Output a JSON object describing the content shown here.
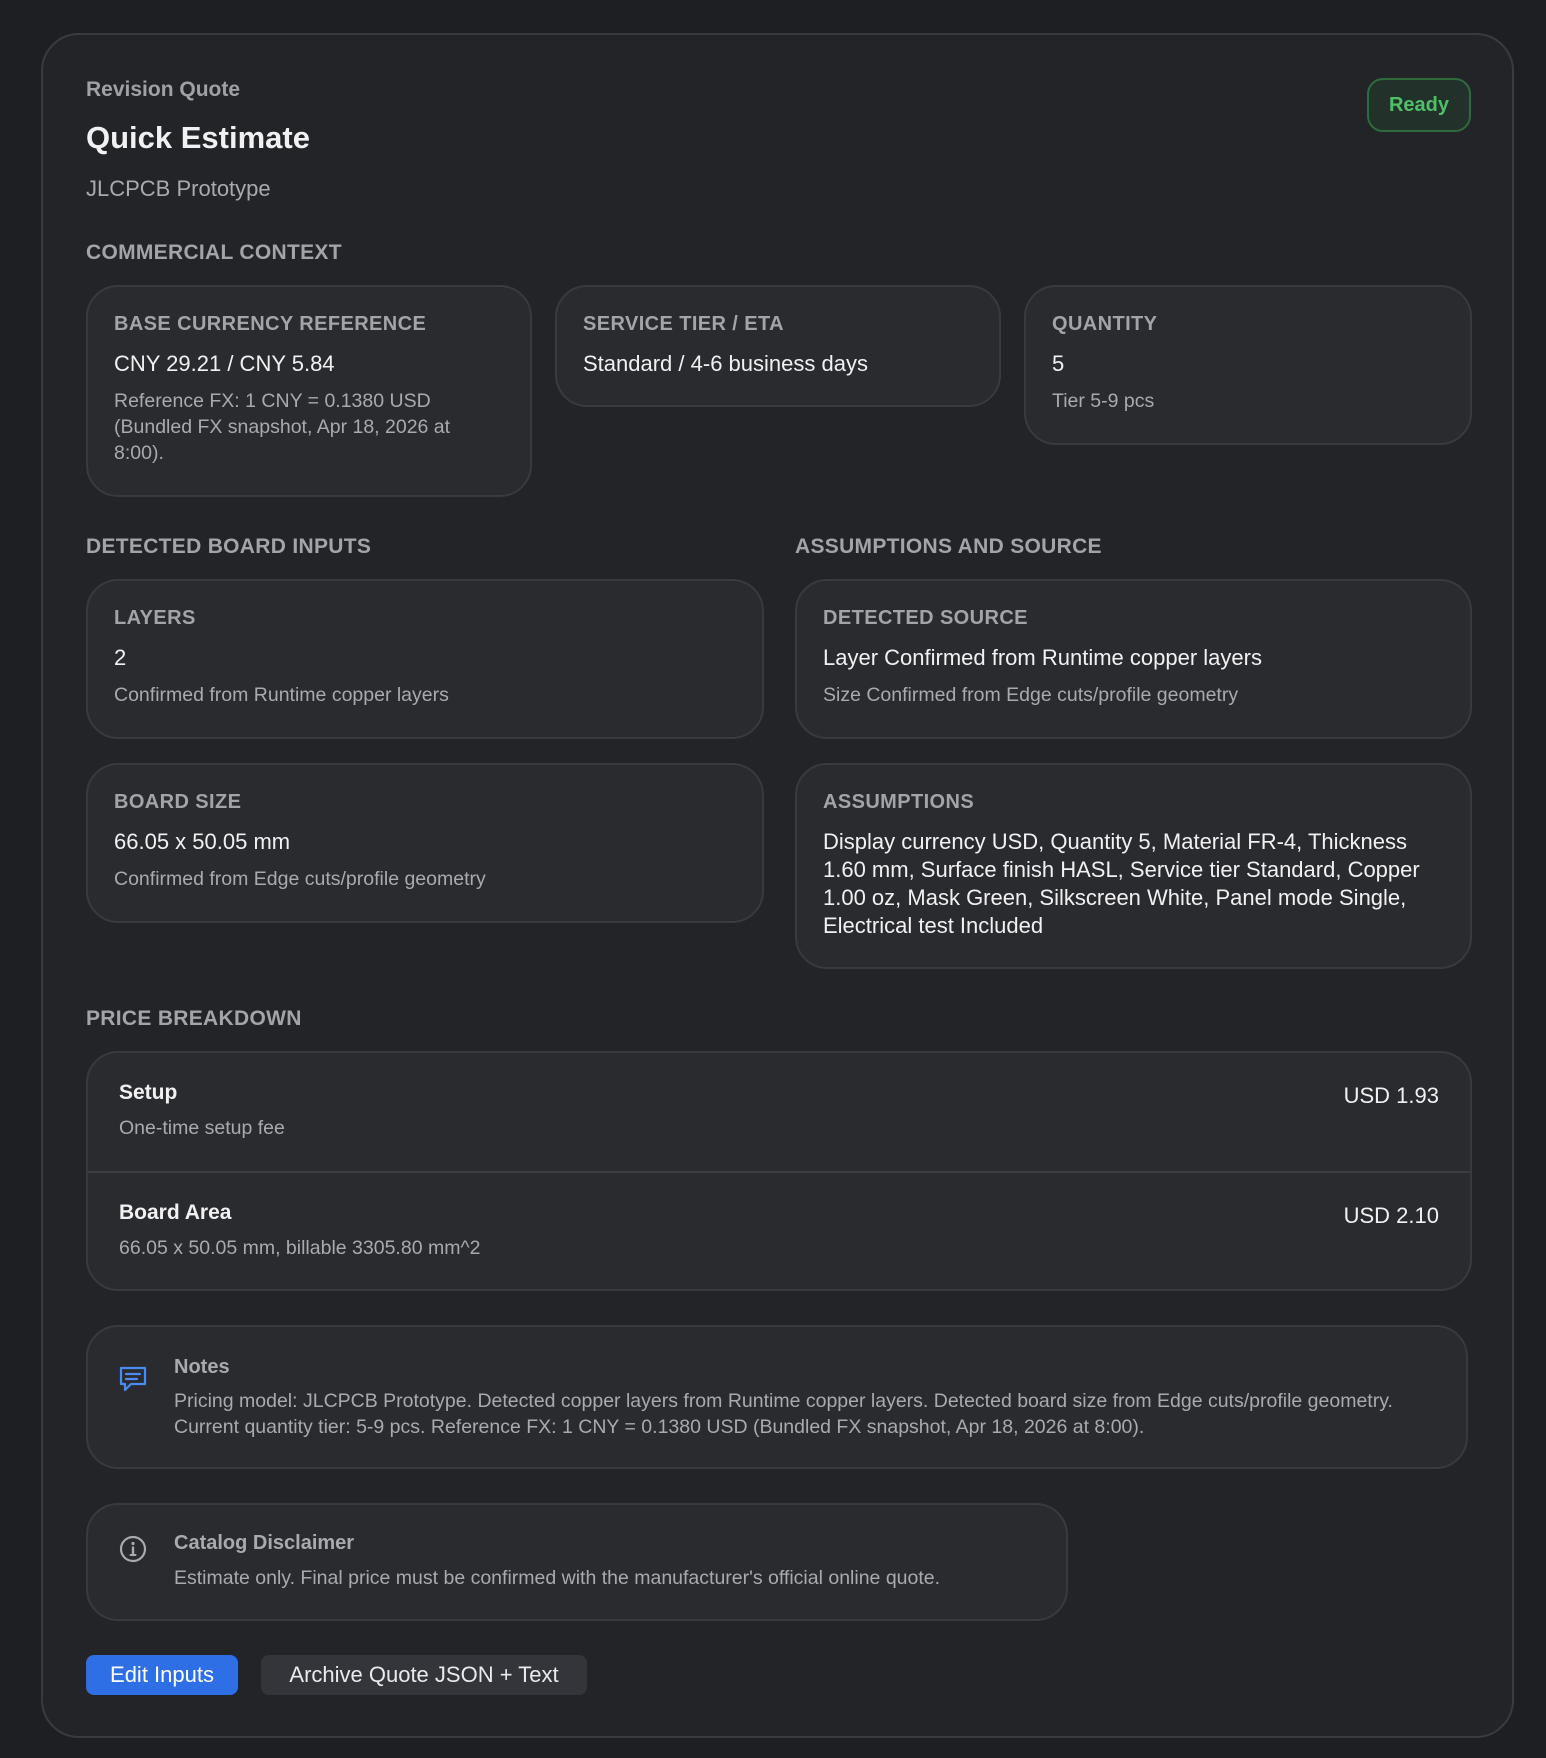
{
  "header": {
    "eyebrow": "Revision Quote",
    "title": "Quick Estimate",
    "subtitle": "JLCPCB Prototype",
    "status": "Ready"
  },
  "commercial": {
    "section_title": "COMMERCIAL CONTEXT",
    "base_currency": {
      "label": "BASE CURRENCY REFERENCE",
      "value": "CNY 29.21 / CNY 5.84",
      "sub": "Reference FX: 1 CNY = 0.1380 USD (Bundled FX snapshot, Apr 18, 2026 at 8:00)."
    },
    "service_tier": {
      "label": "SERVICE TIER / ETA",
      "value": "Standard / 4-6 business days"
    },
    "quantity": {
      "label": "QUANTITY",
      "value": "5",
      "sub": "Tier 5-9 pcs"
    }
  },
  "board_inputs": {
    "section_title": "DETECTED BOARD INPUTS",
    "layers": {
      "label": "LAYERS",
      "value": "2",
      "sub": "Confirmed from Runtime copper layers"
    },
    "board_size": {
      "label": "BOARD SIZE",
      "value": "66.05 x 50.05 mm",
      "sub": "Confirmed from Edge cuts/profile geometry"
    }
  },
  "assumptions_source": {
    "section_title": "ASSUMPTIONS AND SOURCE",
    "detected_source": {
      "label": "DETECTED SOURCE",
      "value": "Layer Confirmed from Runtime copper layers",
      "sub": "Size Confirmed from Edge cuts/profile geometry"
    },
    "assumptions": {
      "label": "ASSUMPTIONS",
      "value": "Display currency USD, Quantity 5, Material FR-4, Thickness 1.60 mm, Surface finish HASL, Service tier Standard, Copper 1.00 oz, Mask Green, Silkscreen White, Panel mode Single, Electrical test Included"
    }
  },
  "price_breakdown": {
    "section_title": "PRICE BREAKDOWN",
    "rows": [
      {
        "name": "Setup",
        "desc": "One-time setup fee",
        "amount": "USD 1.93"
      },
      {
        "name": "Board Area",
        "desc": "66.05 x 50.05 mm, billable 3305.80 mm^2",
        "amount": "USD 2.10"
      }
    ]
  },
  "notes": {
    "icon": "chat-lines-icon",
    "title": "Notes",
    "text": "Pricing model: JLCPCB Prototype. Detected copper layers from Runtime copper layers. Detected board size from Edge cuts/profile geometry. Current quantity tier: 5-9 pcs. Reference FX: 1 CNY = 0.1380 USD (Bundled FX snapshot, Apr 18, 2026 at 8:00)."
  },
  "disclaimer": {
    "icon": "info-circle-icon",
    "title": "Catalog Disclaimer",
    "text": "Estimate only. Final price must be confirmed with the manufacturer's official online quote."
  },
  "actions": {
    "edit_label": "Edit Inputs",
    "archive_label": "Archive Quote JSON + Text"
  },
  "colors": {
    "accent": "#2f6fe6",
    "ready_green": "#4fbf6a",
    "notes_icon": "#4a8cf0"
  }
}
